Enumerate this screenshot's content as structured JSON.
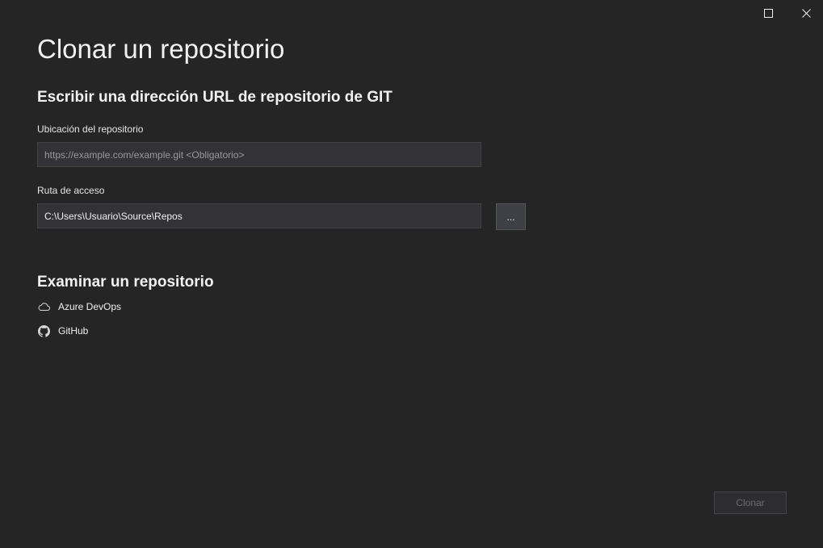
{
  "window": {
    "maximize_icon": "maximize-icon",
    "close_icon": "close-icon"
  },
  "title": "Clonar un repositorio",
  "url_section": {
    "heading": "Escribir una dirección URL de repositorio de GIT",
    "location_label": "Ubicación del repositorio",
    "location_value": "",
    "location_placeholder": "https://example.com/example.git <Obligatorio>",
    "path_label": "Ruta de acceso",
    "path_value": "C:\\Users\\Usuario\\Source\\Repos",
    "browse_label": "..."
  },
  "browse_section": {
    "heading": "Examinar un repositorio",
    "providers": [
      {
        "label": "Azure DevOps",
        "icon": "cloud-icon"
      },
      {
        "label": "GitHub",
        "icon": "github-icon"
      }
    ]
  },
  "footer": {
    "clone_label": "Clonar",
    "clone_enabled": false
  },
  "colors": {
    "background": "#252526",
    "input_background": "#333337",
    "text": "#f1f1f1",
    "disabled_text": "#6d6d6d"
  }
}
